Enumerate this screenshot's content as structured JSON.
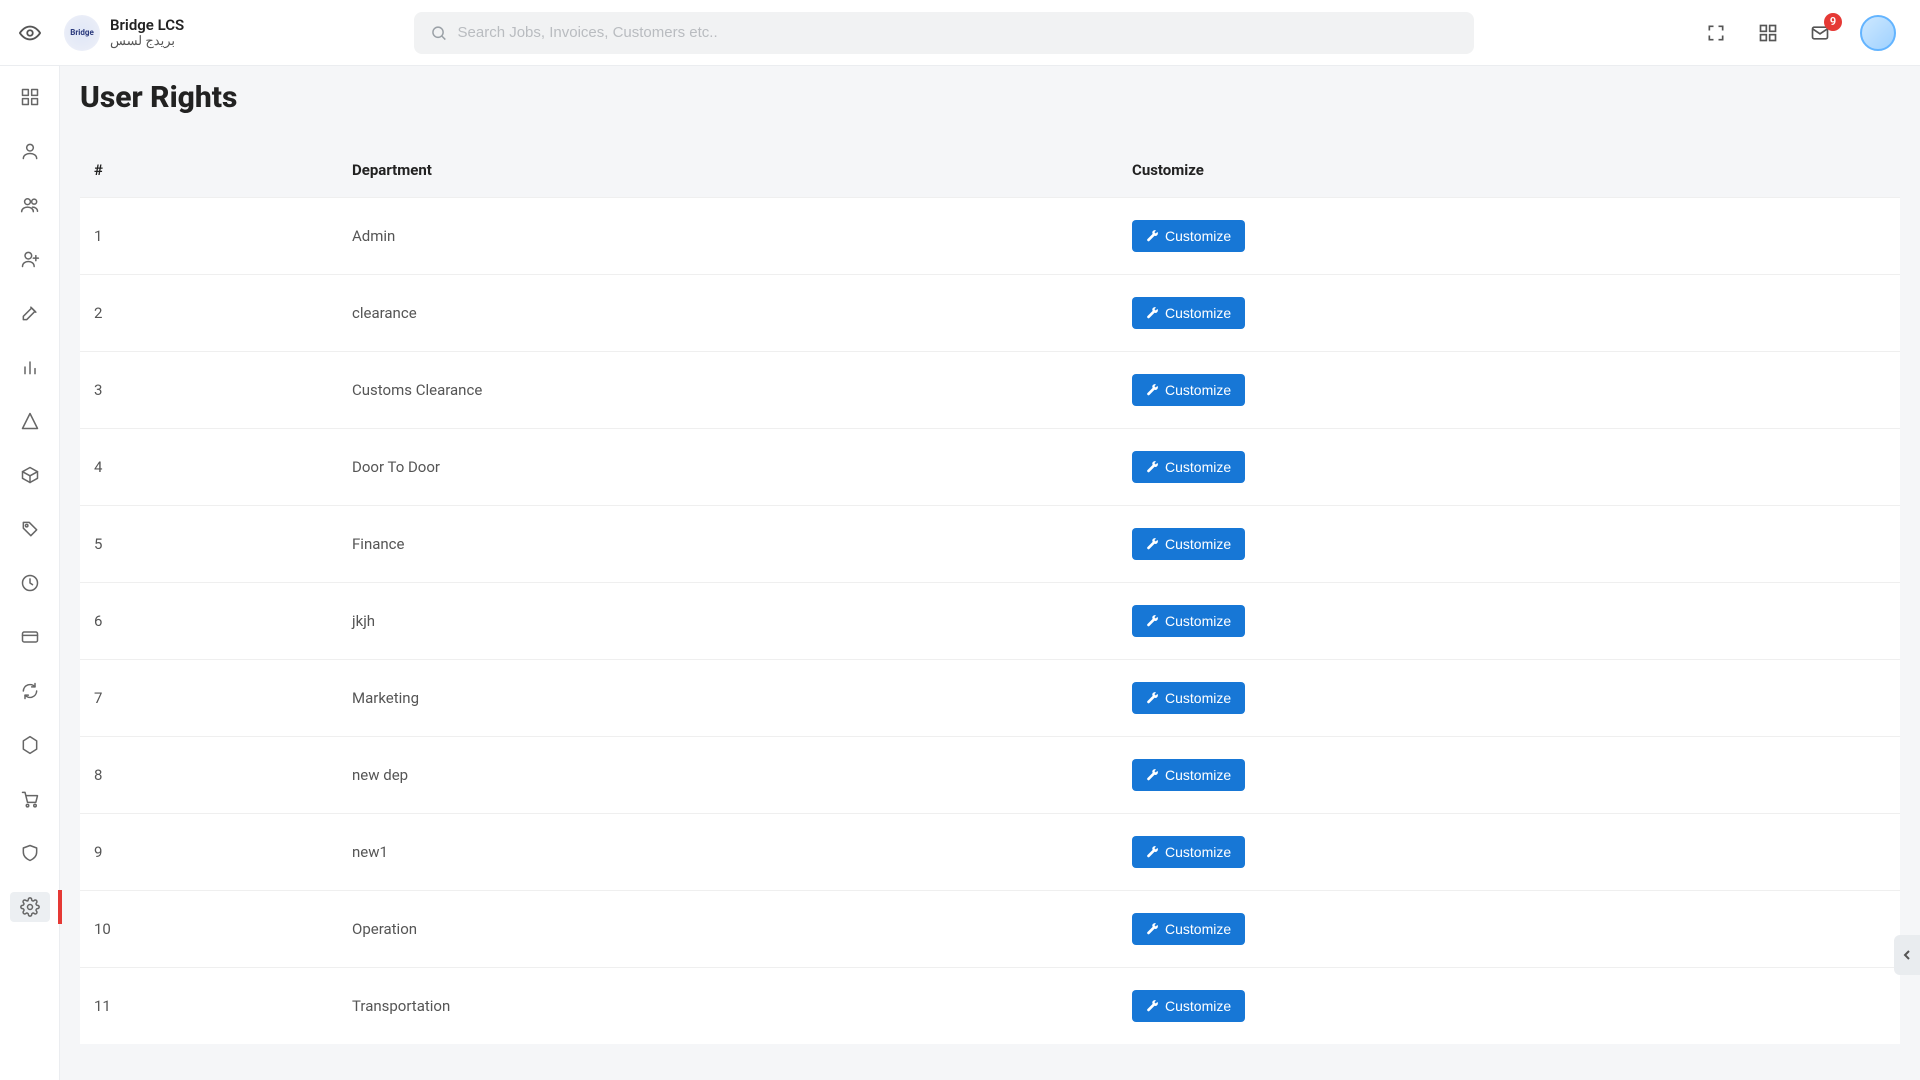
{
  "brand": {
    "name": "Bridge LCS",
    "name_ar": "بريدج لسس",
    "logo_text": "Bridge"
  },
  "search": {
    "placeholder": "Search Jobs, Invoices, Customers etc.."
  },
  "notifications": {
    "count": 9
  },
  "page": {
    "title": "User Rights"
  },
  "table": {
    "columns": {
      "index": "#",
      "department": "Department",
      "customize": "Customize"
    },
    "customize_label": "Customize",
    "rows": [
      {
        "n": "1",
        "name": "Admin"
      },
      {
        "n": "2",
        "name": "clearance"
      },
      {
        "n": "3",
        "name": "Customs Clearance"
      },
      {
        "n": "4",
        "name": "Door To Door"
      },
      {
        "n": "5",
        "name": "Finance"
      },
      {
        "n": "6",
        "name": "jkjh"
      },
      {
        "n": "7",
        "name": "Marketing"
      },
      {
        "n": "8",
        "name": "new dep"
      },
      {
        "n": "9",
        "name": "new1"
      },
      {
        "n": "10",
        "name": "Operation"
      },
      {
        "n": "11",
        "name": "Transportation"
      }
    ]
  },
  "sidebar": {
    "items": [
      {
        "id": "dashboard",
        "icon": "dashboard"
      },
      {
        "id": "user",
        "icon": "user"
      },
      {
        "id": "users",
        "icon": "users"
      },
      {
        "id": "add-user",
        "icon": "user-plus"
      },
      {
        "id": "edit",
        "icon": "edit"
      },
      {
        "id": "reports",
        "icon": "bar-chart"
      },
      {
        "id": "drafts",
        "icon": "pen-line"
      },
      {
        "id": "packages",
        "icon": "box"
      },
      {
        "id": "tags",
        "icon": "tag"
      },
      {
        "id": "time",
        "icon": "clock"
      },
      {
        "id": "cards",
        "icon": "credit-card"
      },
      {
        "id": "sync",
        "icon": "refresh"
      },
      {
        "id": "network",
        "icon": "hexagon"
      },
      {
        "id": "cart",
        "icon": "cart"
      },
      {
        "id": "shield",
        "icon": "shield"
      },
      {
        "id": "settings",
        "icon": "settings",
        "active": true
      }
    ]
  }
}
